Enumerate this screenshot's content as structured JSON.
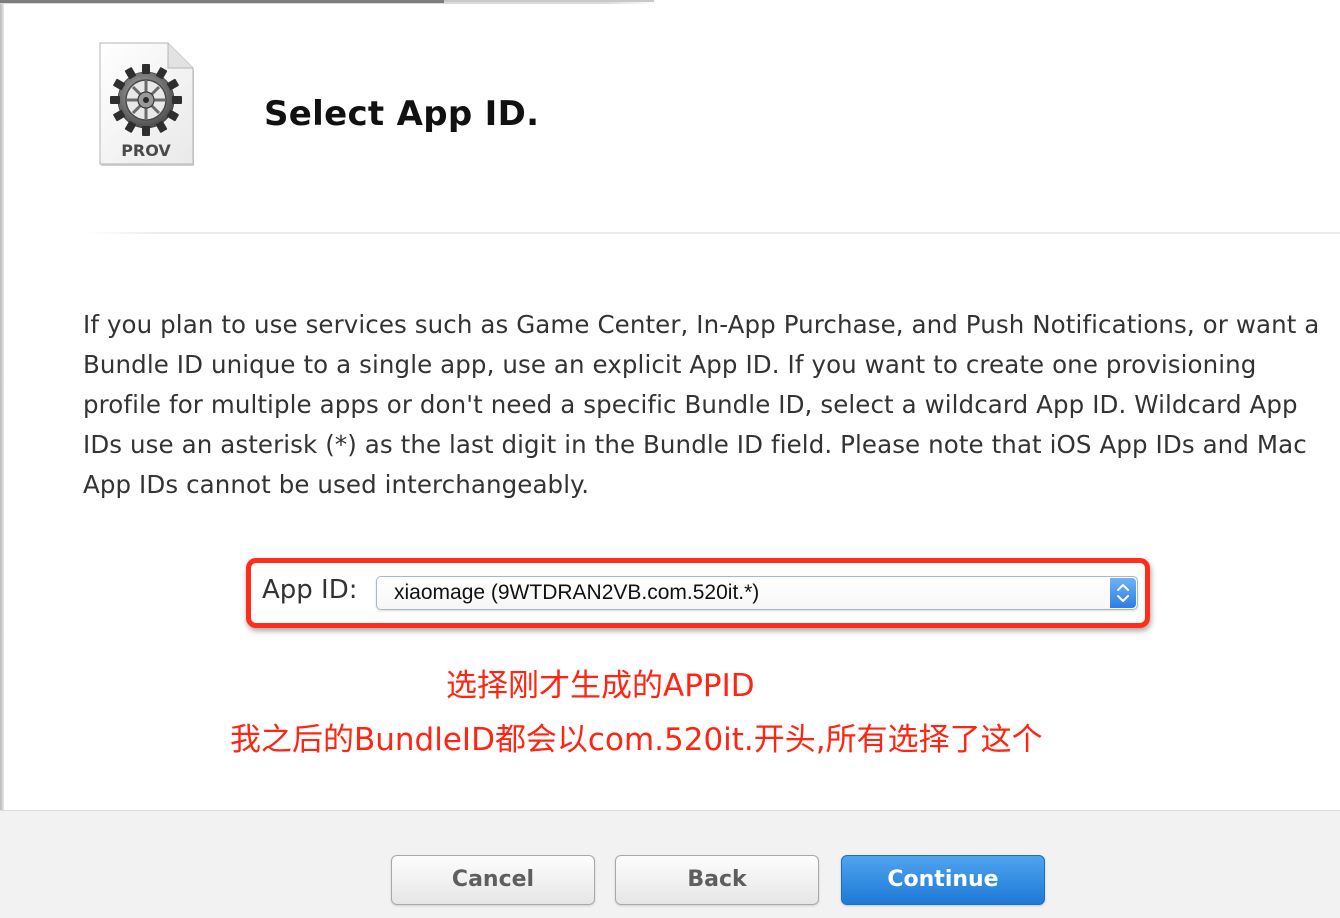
{
  "header": {
    "icon": "provisioning-profile-icon",
    "icon_label": "PROV",
    "title": "Select App ID."
  },
  "description": "If you plan to use services such as Game Center, In-App Purchase, and Push Notifications, or want a Bundle ID unique to a single app, use an explicit App ID. If you want to create one provisioning profile for multiple apps or don't need a specific Bundle ID, select a wildcard App ID. Wildcard App IDs use an asterisk (*) as the last digit in the Bundle ID field. Please note that iOS App IDs and Mac App IDs cannot be used interchangeably.",
  "app_id_field": {
    "label": "App ID:",
    "selected_value": "xiaomage (9WTDRAN2VB.com.520it.*)"
  },
  "annotations": [
    "选择刚才生成的APPID",
    "我之后的BundleID都会以com.520it.开头,所有选择了这个"
  ],
  "buttons": {
    "cancel": "Cancel",
    "back": "Back",
    "continue": "Continue"
  },
  "colors": {
    "annotation_red": "#ff2512",
    "highlight_border": "#ff2d1a",
    "primary_blue": "#1f79d6"
  }
}
